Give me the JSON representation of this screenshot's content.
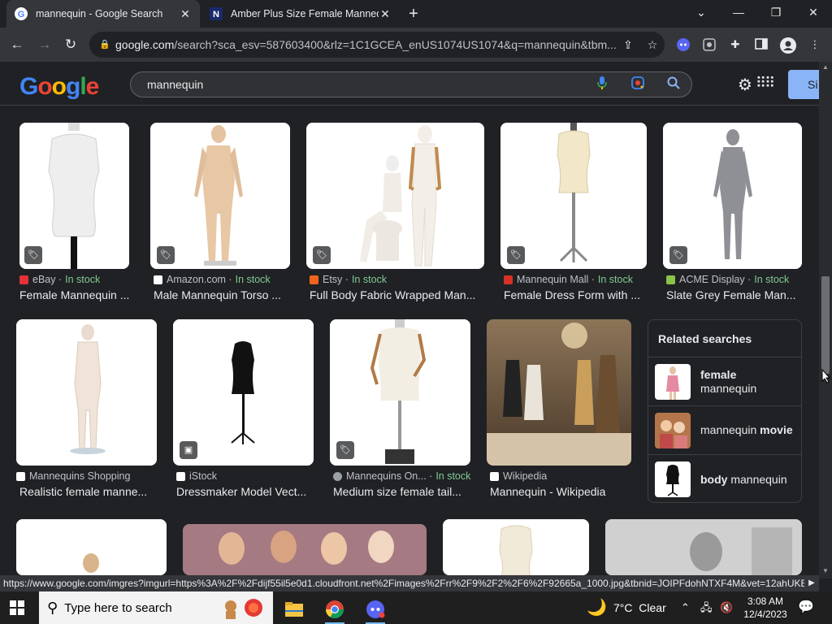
{
  "browser": {
    "tabs": [
      {
        "title": "mannequin - Google Search",
        "active": true
      },
      {
        "title": "Amber Plus Size Female Mannequ",
        "active": false
      }
    ],
    "url_host": "google.com",
    "url_rest": "/search?sca_esv=587603400&rlz=1C1GCEA_enUS1074US1074&q=mannequin&tbm..."
  },
  "google": {
    "logo": "Google",
    "query": "mannequin",
    "signin_label": "Si"
  },
  "results_row1": [
    {
      "source": "eBay",
      "stock": "In stock",
      "title": "Female Mannequin ...",
      "fav_color": "#e53238"
    },
    {
      "source": "Amazon.com",
      "stock": "In stock",
      "title": "Male Mannequin Torso ...",
      "fav_color": "#ffffff"
    },
    {
      "source": "Etsy",
      "stock": "In stock",
      "title": "Full Body Fabric Wrapped Man...",
      "fav_color": "#f1641e"
    },
    {
      "source": "Mannequin Mall",
      "stock": "In stock",
      "title": "Female Dress Form with ...",
      "fav_color": "#d93025"
    },
    {
      "source": "ACME Display",
      "stock": "In stock",
      "title": "Slate Grey Female Man...",
      "fav_color": "#8bc34a"
    }
  ],
  "results_row2": [
    {
      "source": "Mannequins Shopping",
      "title": "Realistic female manne..."
    },
    {
      "source": "iStock",
      "title": "Dressmaker Model Vect..."
    },
    {
      "source": "Mannequins On...",
      "stock": "In stock",
      "title": "Medium size female tail..."
    },
    {
      "source": "Wikipedia",
      "title": "Mannequin - Wikipedia"
    }
  ],
  "related": {
    "header": "Related searches",
    "items": [
      {
        "bold": "female",
        "rest": "mannequin"
      },
      {
        "pre": "mannequin ",
        "bold": "movie"
      },
      {
        "bold": "body",
        "rest": " mannequin"
      }
    ]
  },
  "status_url": "https://www.google.com/imgres?imgurl=https%3A%2F%2Fdijf55il5e0d1.cloudfront.net%2Fimages%2Frr%2F9%2F2%2F6%2F92665a_1000.jpg&tbnid=JOIPFdohNTXF4M&vet=12ahUKE...",
  "taskbar": {
    "search_placeholder": "Type here to search",
    "weather_temp": "7°C",
    "weather_desc": "Clear",
    "time": "3:08 AM",
    "date": "12/4/2023"
  }
}
